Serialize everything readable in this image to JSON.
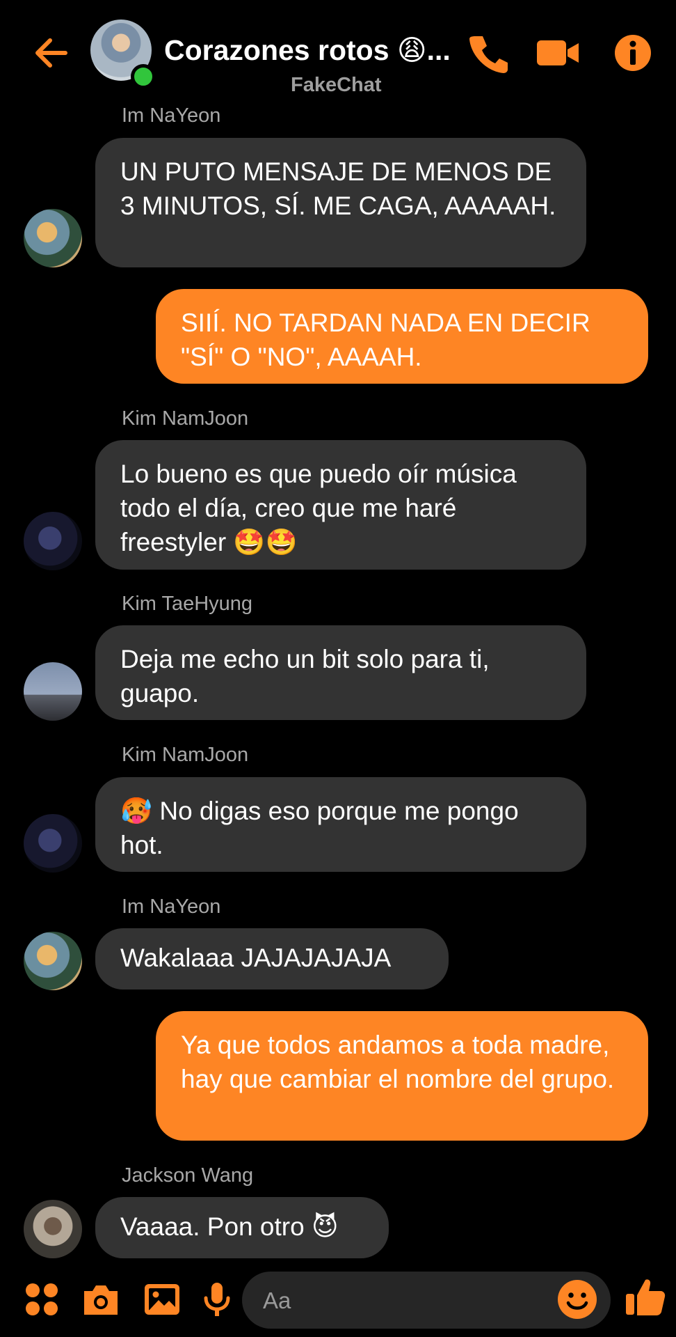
{
  "theme": {
    "accent": "#fe8524",
    "incoming_bubble": "#333333",
    "outgoing_bubble": "#fe8524",
    "background": "#000000",
    "online": "#31c53c"
  },
  "header": {
    "title": "Corazones rotos 😩...",
    "subtitle": "FakeChat",
    "icons": [
      "back-arrow-icon",
      "phone-icon",
      "video-camera-icon",
      "info-icon"
    ]
  },
  "messages": [
    {
      "sender": "Im NaYeon",
      "text": "UN PUTO MENSAJE DE MENOS DE 3 MINUTOS, SÍ. ME CAGA, AAAAAH."
    },
    {
      "text": "SIIÍ. NO TARDAN NADA EN DECIR \"SÍ\" O \"NO\", AAAAH."
    },
    {
      "sender": "Kim NamJoon",
      "text": "Lo bueno es que puedo oír música todo el día, creo que me haré freestyler 🤩🤩"
    },
    {
      "sender": "Kim TaeHyung",
      "text": "Deja me echo un bit solo para ti, guapo."
    },
    {
      "sender": "Kim NamJoon",
      "text": "🥵 No digas eso porque me pongo hot."
    },
    {
      "sender": "Im NaYeon",
      "text": "Wakalaaa JAJAJAJAJA"
    },
    {
      "text": "Ya que todos andamos a toda madre, hay que cambiar el nombre del grupo."
    },
    {
      "sender": "Jackson Wang",
      "text": "Vaaaa. Pon otro 😈"
    }
  ],
  "composer": {
    "placeholder": "Aa",
    "icons": [
      "apps-icon",
      "camera-icon",
      "gallery-icon",
      "microphone-icon",
      "emoji-icon",
      "thumbs-up-icon"
    ]
  }
}
